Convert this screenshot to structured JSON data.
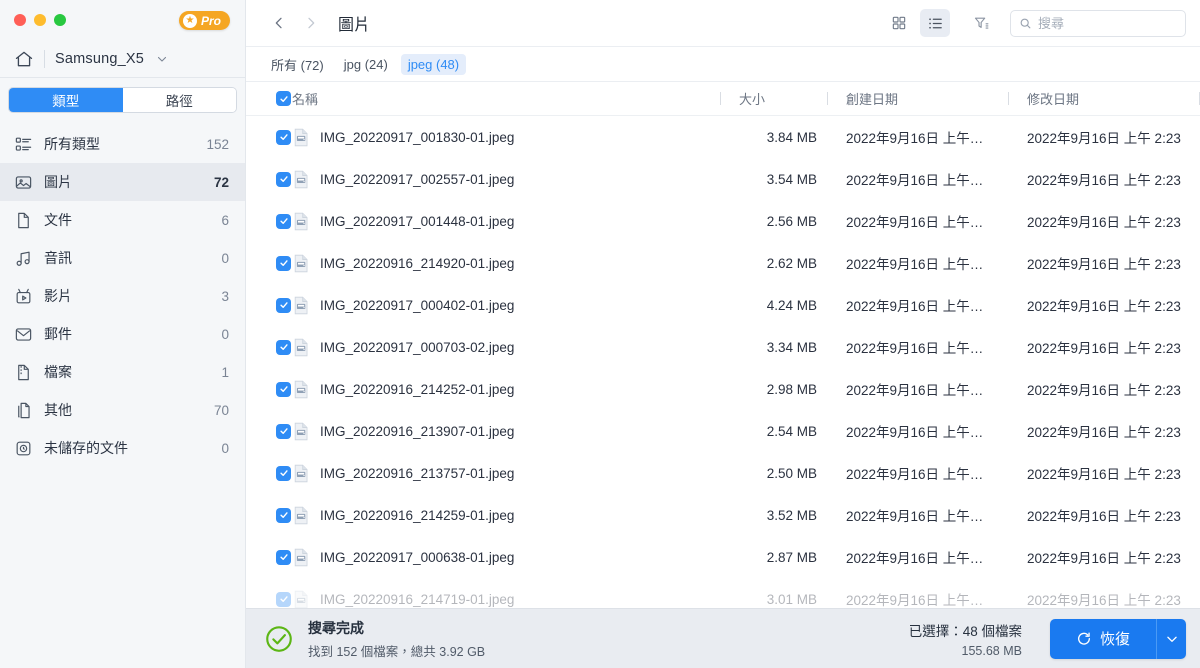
{
  "window": {
    "traffic_lights": [
      "close",
      "minimize",
      "maximize"
    ],
    "pro_badge": "Pro",
    "drive_name": "Samsung_X5"
  },
  "sidebar": {
    "tabs": [
      {
        "label": "類型",
        "active": true
      },
      {
        "label": "路徑",
        "active": false
      }
    ],
    "items": [
      {
        "icon": "all-types-icon",
        "label": "所有類型",
        "count": "152",
        "active": false
      },
      {
        "icon": "image-icon",
        "label": "圖片",
        "count": "72",
        "active": true
      },
      {
        "icon": "document-icon",
        "label": "文件",
        "count": "6",
        "active": false
      },
      {
        "icon": "audio-icon",
        "label": "音訊",
        "count": "0",
        "active": false
      },
      {
        "icon": "video-icon",
        "label": "影片",
        "count": "3",
        "active": false
      },
      {
        "icon": "mail-icon",
        "label": "郵件",
        "count": "0",
        "active": false
      },
      {
        "icon": "archive-icon",
        "label": "檔案",
        "count": "1",
        "active": false
      },
      {
        "icon": "other-icon",
        "label": "其他",
        "count": "70",
        "active": false
      },
      {
        "icon": "unsaved-icon",
        "label": "未儲存的文件",
        "count": "0",
        "active": false
      }
    ]
  },
  "toolbar": {
    "back_icon": "chevron-left-icon",
    "forward_icon": "chevron-right-icon",
    "breadcrumb": "圖片",
    "grid_view_icon": "grid-view-icon",
    "list_view_icon": "list-view-icon",
    "filter_icon": "filter-icon",
    "search_placeholder": "搜尋",
    "search_value": ""
  },
  "chips": [
    {
      "label": "所有 (72)",
      "active": false
    },
    {
      "label": "jpg (24)",
      "active": false
    },
    {
      "label": "jpeg (48)",
      "active": true
    }
  ],
  "table": {
    "headers": {
      "name": "名稱",
      "size": "大小",
      "created": "創建日期",
      "modified": "修改日期"
    },
    "select_all_checked": true,
    "rows": [
      {
        "checked": true,
        "name": "IMG_20220917_001830-01.jpeg",
        "size": "3.84 MB",
        "created": "2022年9月16日 上午…",
        "modified": "2022年9月16日 上午 2:23"
      },
      {
        "checked": true,
        "name": "IMG_20220917_002557-01.jpeg",
        "size": "3.54 MB",
        "created": "2022年9月16日 上午…",
        "modified": "2022年9月16日 上午 2:23"
      },
      {
        "checked": true,
        "name": "IMG_20220917_001448-01.jpeg",
        "size": "2.56 MB",
        "created": "2022年9月16日 上午…",
        "modified": "2022年9月16日 上午 2:23"
      },
      {
        "checked": true,
        "name": "IMG_20220916_214920-01.jpeg",
        "size": "2.62 MB",
        "created": "2022年9月16日 上午…",
        "modified": "2022年9月16日 上午 2:23"
      },
      {
        "checked": true,
        "name": "IMG_20220917_000402-01.jpeg",
        "size": "4.24 MB",
        "created": "2022年9月16日 上午…",
        "modified": "2022年9月16日 上午 2:23"
      },
      {
        "checked": true,
        "name": "IMG_20220917_000703-02.jpeg",
        "size": "3.34 MB",
        "created": "2022年9月16日 上午…",
        "modified": "2022年9月16日 上午 2:23"
      },
      {
        "checked": true,
        "name": "IMG_20220916_214252-01.jpeg",
        "size": "2.98 MB",
        "created": "2022年9月16日 上午…",
        "modified": "2022年9月16日 上午 2:23"
      },
      {
        "checked": true,
        "name": "IMG_20220916_213907-01.jpeg",
        "size": "2.54 MB",
        "created": "2022年9月16日 上午…",
        "modified": "2022年9月16日 上午 2:23"
      },
      {
        "checked": true,
        "name": "IMG_20220916_213757-01.jpeg",
        "size": "2.50 MB",
        "created": "2022年9月16日 上午…",
        "modified": "2022年9月16日 上午 2:23"
      },
      {
        "checked": true,
        "name": "IMG_20220916_214259-01.jpeg",
        "size": "3.52 MB",
        "created": "2022年9月16日 上午…",
        "modified": "2022年9月16日 上午 2:23"
      },
      {
        "checked": true,
        "name": "IMG_20220917_000638-01.jpeg",
        "size": "2.87 MB",
        "created": "2022年9月16日 上午…",
        "modified": "2022年9月16日 上午 2:23"
      },
      {
        "checked": true,
        "name": "IMG_20220916_214719-01.jpeg",
        "size": "3.01 MB",
        "created": "2022年9月16日 上午…",
        "modified": "2022年9月16日 上午 2:23"
      }
    ]
  },
  "statusbar": {
    "status_icon": "check-circle-icon",
    "title": "搜尋完成",
    "subtitle": "找到 152 個檔案，總共 3.92 GB",
    "found_count": "152",
    "total_size": "3.92 GB",
    "selected_label": "已選擇：48 個檔案",
    "selected_size": "155.68 MB",
    "recover_button": "恢復",
    "recover_icon": "refresh-icon",
    "recover_dropdown_icon": "chevron-down-icon"
  },
  "colors": {
    "accent": "#2f8cf5",
    "recover_blue": "#1a7af0",
    "pro_orange": "#f5a623",
    "success_green": "#5cb615",
    "sidebar_bg": "#f5f7f9",
    "statusbar_bg": "#e9ecf1"
  }
}
